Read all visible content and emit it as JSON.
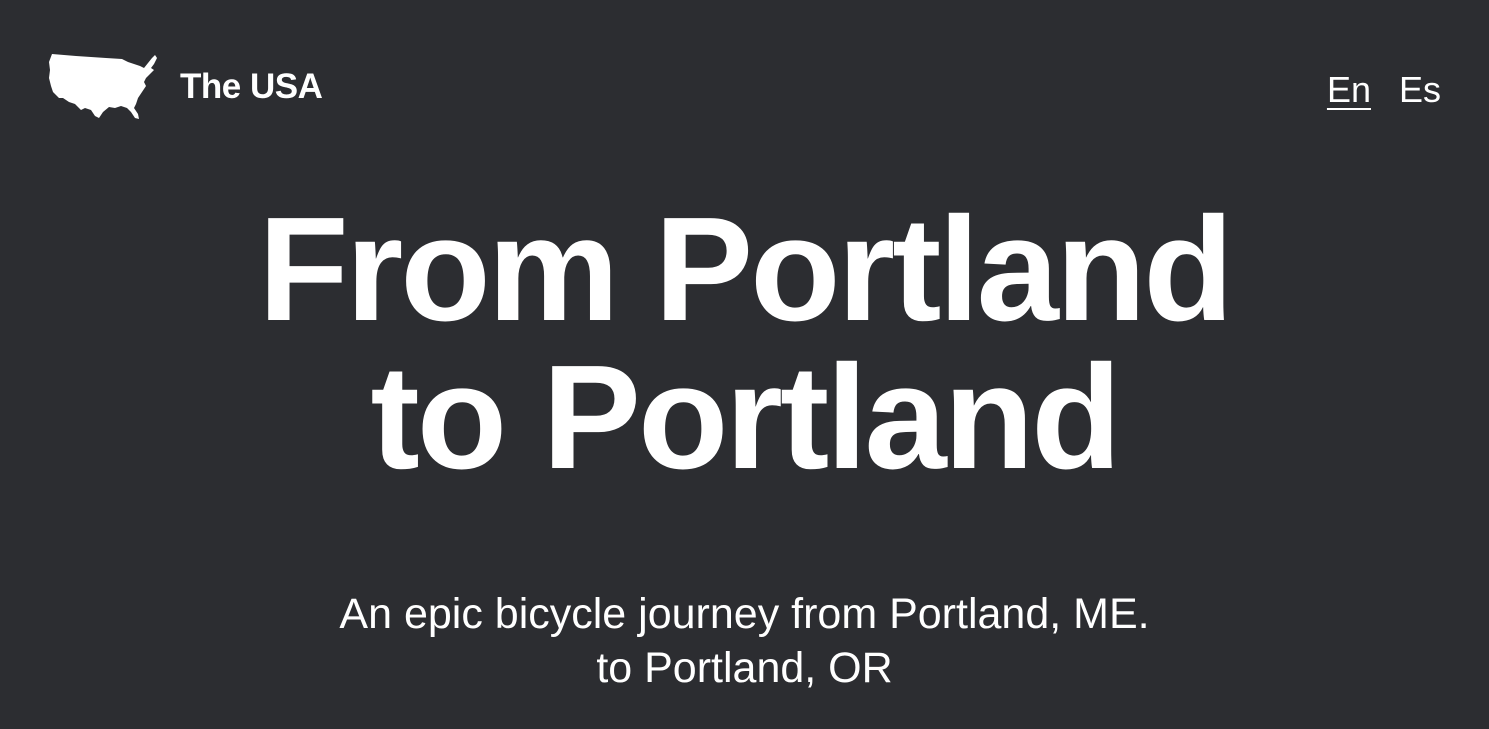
{
  "header": {
    "brand_title": "The USA",
    "brand_icon": "usa-map-icon",
    "languages": [
      {
        "label": "En",
        "active": true
      },
      {
        "label": "Es",
        "active": false
      }
    ]
  },
  "hero": {
    "title_line1": "From Portland",
    "title_line2": "to Portland",
    "subtitle_line1": "An epic bicycle journey from Portland, ME.",
    "subtitle_line2": "to Portland, OR"
  },
  "colors": {
    "background": "#2c2d31",
    "foreground": "#ffffff"
  }
}
